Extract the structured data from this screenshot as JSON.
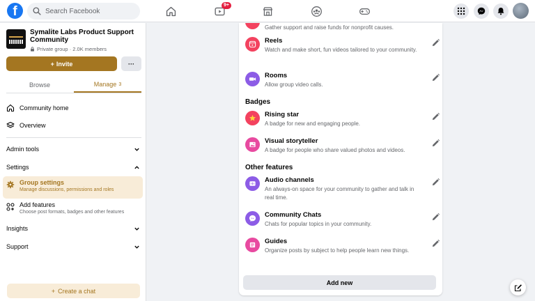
{
  "topbar": {
    "logo_letter": "f",
    "search_placeholder": "Search Facebook",
    "notification_badge": "9+"
  },
  "sidebar": {
    "group_name": "Symalite Labs Product Support Community",
    "group_meta": "Private group · 2.0K members",
    "invite_label": "Invite",
    "more_label": "···",
    "tabs": {
      "browse": "Browse",
      "manage": "Manage",
      "manage_count": "3"
    },
    "community_home": "Community home",
    "overview": "Overview",
    "admin_tools": "Admin tools",
    "settings": "Settings",
    "group_settings": {
      "title": "Group settings",
      "subtitle": "Manage discussions, permissions and roles"
    },
    "add_features": {
      "title": "Add features",
      "subtitle": "Choose post formats, badges and other features"
    },
    "insights": "Insights",
    "support": "Support",
    "create_chat": "Create a chat"
  },
  "main": {
    "top_partial_desc": "Gather support and raise funds for nonprofit causes.",
    "features": [
      {
        "title": "Reels",
        "description": "Watch and make short, fun videos tailored to your community."
      },
      {
        "title": "Rooms",
        "description": "Allow group video calls."
      }
    ],
    "badges_heading": "Badges",
    "badges": [
      {
        "title": "Rising star",
        "description": "A badge for new and engaging people."
      },
      {
        "title": "Visual storyteller",
        "description": "A badge for people who share valued photos and videos."
      }
    ],
    "other_heading": "Other features",
    "other": [
      {
        "title": "Audio channels",
        "description": "An always-on space for your community to gather and talk in real time."
      },
      {
        "title": "Community Chats",
        "description": "Chats for popular topics in your community."
      },
      {
        "title": "Guides",
        "description": "Organize posts by subject to help people learn new things."
      }
    ],
    "add_new_label": "Add new"
  },
  "colors": {
    "accent": "#a47621",
    "accent_light": "#f8ecd8",
    "facebook_blue": "#1877f2",
    "reels_red": "#f3425f",
    "purple": "#8c5ce6",
    "pink": "#e84aa0"
  }
}
